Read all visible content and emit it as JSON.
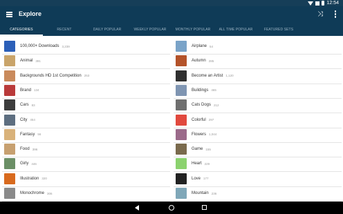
{
  "status_bar": {
    "time": "12:54"
  },
  "app_bar": {
    "title": "Explore"
  },
  "tabs": [
    {
      "label": "CATEGORIES",
      "active": true
    },
    {
      "label": "RECENT",
      "active": false
    },
    {
      "label": "DAILY POPULAR",
      "active": false
    },
    {
      "label": "WEEKLY POPULAR",
      "active": false
    },
    {
      "label": "MONTHLY POPULAR",
      "active": false
    },
    {
      "label": "ALL TIME POPULAR",
      "active": false
    },
    {
      "label": "FEATURED SETS",
      "active": false
    }
  ],
  "left_categories": [
    {
      "name": "100,000+ Downloads",
      "count": "3,239",
      "color": "#2b5fb8"
    },
    {
      "name": "Animal",
      "count": "391",
      "color": "#c9a46a"
    },
    {
      "name": "Backgrounds HD 1st Competition",
      "count": "253",
      "color": "#c98a5c"
    },
    {
      "name": "Brand",
      "count": "134",
      "color": "#b93a3a"
    },
    {
      "name": "Cars",
      "count": "83",
      "color": "#3d3d3d"
    },
    {
      "name": "City",
      "count": "454",
      "color": "#5d6e80"
    },
    {
      "name": "Fantasy",
      "count": "56",
      "color": "#d9b27a"
    },
    {
      "name": "Food",
      "count": "396",
      "color": "#c7a070"
    },
    {
      "name": "Girly",
      "count": "446",
      "color": "#6b8f66"
    },
    {
      "name": "Illustration",
      "count": "320",
      "color": "#d86a1e"
    },
    {
      "name": "Monochrome",
      "count": "306",
      "color": "#8a8a8a"
    }
  ],
  "right_categories": [
    {
      "name": "Airplane",
      "count": "54",
      "color": "#7aa3c8"
    },
    {
      "name": "Autumn",
      "count": "285",
      "color": "#b4532a"
    },
    {
      "name": "Become an Artist",
      "count": "1,120",
      "color": "#2f2f2f"
    },
    {
      "name": "Buildings",
      "count": "465",
      "color": "#7f95b2"
    },
    {
      "name": "Cats Dogs",
      "count": "212",
      "color": "#6f6f6f"
    },
    {
      "name": "Colorful",
      "count": "297",
      "color": "#e1493e"
    },
    {
      "name": "Flowers",
      "count": "1,044",
      "color": "#9b6a8a"
    },
    {
      "name": "Game",
      "count": "155",
      "color": "#7a6a4d"
    },
    {
      "name": "Heart",
      "count": "229",
      "color": "#8bd26e"
    },
    {
      "name": "Love",
      "count": "177",
      "color": "#222222"
    },
    {
      "name": "Mountain",
      "count": "236",
      "color": "#7fa7b8"
    }
  ]
}
